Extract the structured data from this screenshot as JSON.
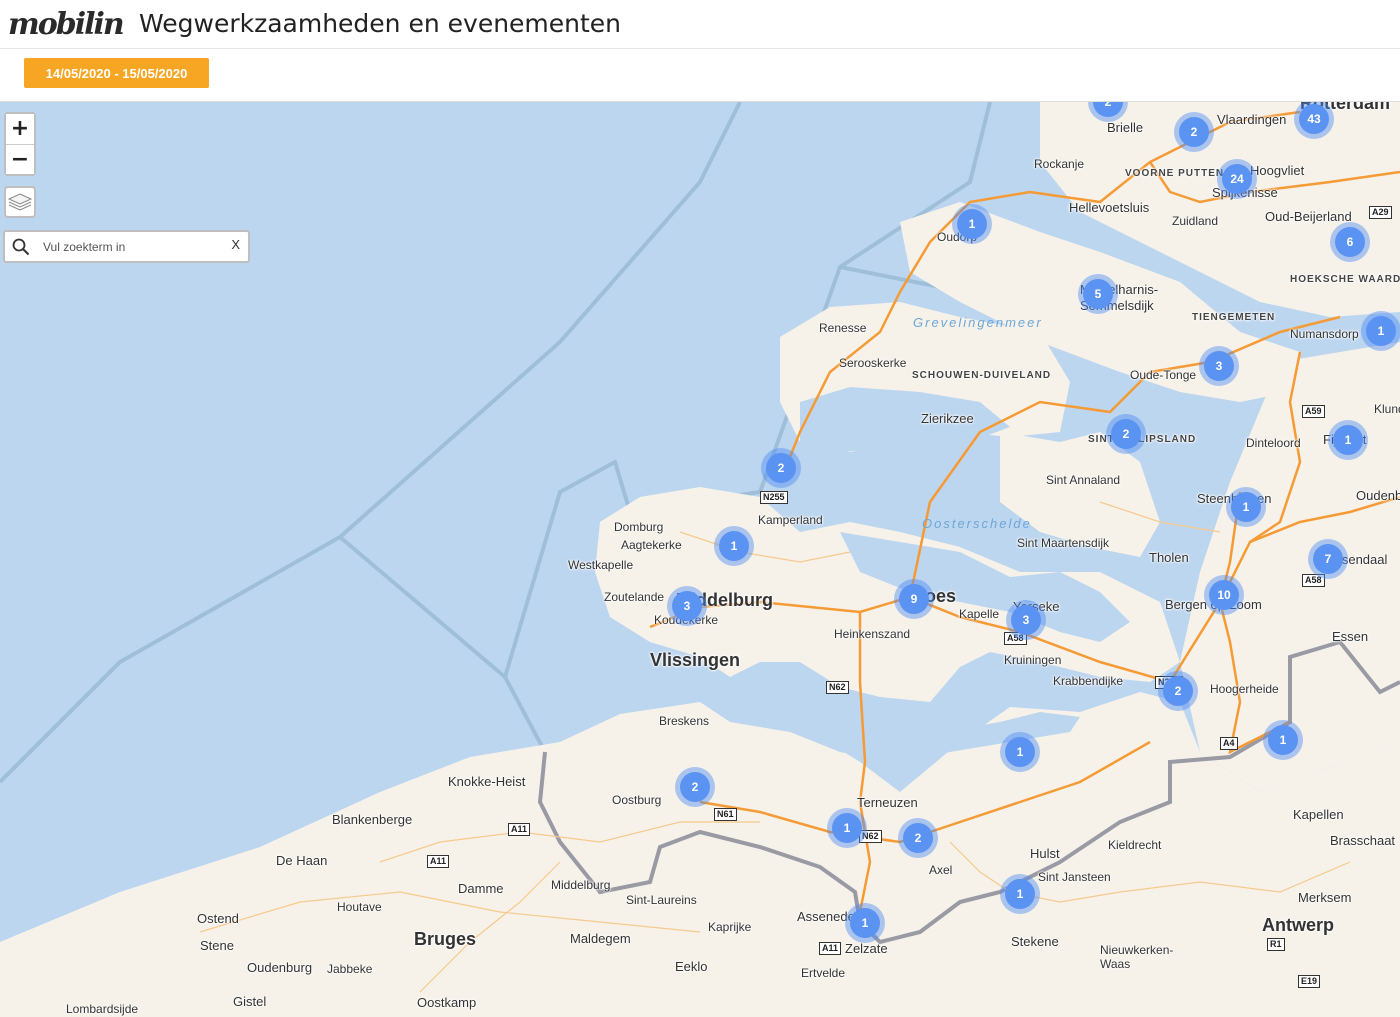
{
  "header": {
    "logo_text": "mobilin",
    "title": "Wegwerkzaamheden en evenementen"
  },
  "filter": {
    "date_range": "14/05/2020 - 15/05/2020",
    "accent_color": "#f6a623"
  },
  "map_controls": {
    "zoom_in": "+",
    "zoom_out": "−",
    "layers_icon": "layers-icon",
    "search_placeholder": "Vul zoekterm in",
    "search_clear": "X"
  },
  "clusters": [
    {
      "count": "2"
    },
    {
      "count": "2"
    },
    {
      "count": "43"
    },
    {
      "count": "24"
    },
    {
      "count": "1"
    },
    {
      "count": "6"
    },
    {
      "count": "5"
    },
    {
      "count": "1"
    },
    {
      "count": "3"
    },
    {
      "count": "2"
    },
    {
      "count": "1"
    },
    {
      "count": "2"
    },
    {
      "count": "1"
    },
    {
      "count": "1"
    },
    {
      "count": "7"
    },
    {
      "count": "3"
    },
    {
      "count": "9"
    },
    {
      "count": "3"
    },
    {
      "count": "10"
    },
    {
      "count": "2"
    },
    {
      "count": "1"
    },
    {
      "count": "1"
    },
    {
      "count": "2"
    },
    {
      "count": "1"
    },
    {
      "count": "2"
    },
    {
      "count": "1"
    },
    {
      "count": "1"
    }
  ],
  "places": [
    "Brielle",
    "Vlaardingen",
    "Rotterdam",
    "Rockanje",
    "VOORNE PUTTEN",
    "Hoogvliet",
    "Spijkenisse",
    "Hellevoetsluis",
    "Zuidland",
    "Oud-Beijerland",
    "Oudorp",
    "HOEKSCHE WAARD",
    "Middelharnis-Sommelsdijk",
    "Renesse",
    "Grevelingenmeer",
    "TIENGEMETEN",
    "Numansdorp",
    "Serooskerke",
    "SCHOUWEN-DUIVELAND",
    "Oude-Tonge",
    "Zierikzee",
    "Klunde",
    "SINT PHILIPSLAND",
    "Dinteloord",
    "Fijnaart",
    "Sint Annaland",
    "Kamperland",
    "Steenbergen",
    "Oudenbosch",
    "Domburg",
    "Aagtekerke",
    "Oosterschelde",
    "Sint Maartensdijk",
    "Westkapelle",
    "Tholen",
    "Roosendaal",
    "Zoutelande",
    "Middelburg",
    "Goes",
    "Koudekerke",
    "Kapelle",
    "Yerseke",
    "Bergen op Zoom",
    "Heinkenszand",
    "Essen",
    "Vlissingen",
    "Kruiningen",
    "Krabbendijke",
    "Hoogerheide",
    "Breskens",
    "Knokke-Heist",
    "Oostburg",
    "Terneuzen",
    "Kapellen",
    "Blankenberge",
    "Hulst",
    "Kieldrecht",
    "Brasschaat",
    "De Haan",
    "Axel",
    "Sint Jansteen",
    "Damme",
    "Middelburg",
    "Merksem",
    "Houtave",
    "Sint-Laureins",
    "Assenede",
    "Ostend",
    "Stene",
    "Bruges",
    "Maldegem",
    "Kaprijke",
    "Zelzate",
    "Stekene",
    "Antwerp",
    "Oudenburg",
    "Jabbeke",
    "Eeklo",
    "Ertvelde",
    "Nieuwkerken-Waas",
    "Gistel",
    "Lombardsijde",
    "Oostkamp"
  ],
  "roads": [
    "A29",
    "A59",
    "A58",
    "A4",
    "A58",
    "N255",
    "N62",
    "N61",
    "N62",
    "A11",
    "A11",
    "A11",
    "R1",
    "E19",
    "N289"
  ]
}
